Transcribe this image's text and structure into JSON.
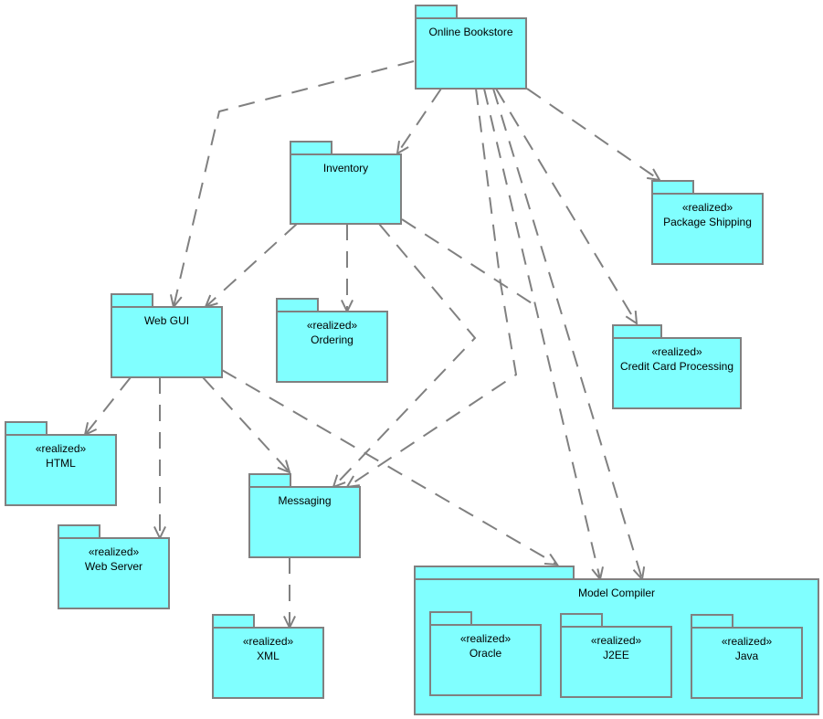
{
  "colors": {
    "fill": "#80ffff",
    "stroke": "#808080"
  },
  "packages": {
    "bookstore": {
      "name": "Online Bookstore",
      "stereotype": ""
    },
    "inventory": {
      "name": "Inventory",
      "stereotype": ""
    },
    "shipping": {
      "name": "Package Shipping",
      "stereotype": "«realized»"
    },
    "webgui": {
      "name": "Web GUI",
      "stereotype": ""
    },
    "ordering": {
      "name": "Ordering",
      "stereotype": "«realized»"
    },
    "credit": {
      "name": "Credit Card Processing",
      "stereotype": "«realized»"
    },
    "html": {
      "name": "HTML",
      "stereotype": "«realized»"
    },
    "messaging": {
      "name": "Messaging",
      "stereotype": ""
    },
    "webserver": {
      "name": "Web Server",
      "stereotype": "«realized»"
    },
    "xml": {
      "name": "XML",
      "stereotype": "«realized»"
    },
    "compiler": {
      "name": "Model Compiler",
      "stereotype": ""
    },
    "oracle": {
      "name": "Oracle",
      "stereotype": "«realized»"
    },
    "j2ee": {
      "name": "J2EE",
      "stereotype": "«realized»"
    },
    "java": {
      "name": "Java",
      "stereotype": "«realized»"
    }
  },
  "dependencies": [
    {
      "from": "bookstore",
      "to": "webgui"
    },
    {
      "from": "bookstore",
      "to": "inventory"
    },
    {
      "from": "bookstore",
      "to": "shipping"
    },
    {
      "from": "bookstore",
      "to": "credit"
    },
    {
      "from": "bookstore",
      "to": "messaging"
    },
    {
      "from": "bookstore",
      "to": "compiler"
    },
    {
      "from": "bookstore",
      "to": "compiler"
    },
    {
      "from": "inventory",
      "to": "webgui"
    },
    {
      "from": "inventory",
      "to": "ordering"
    },
    {
      "from": "inventory",
      "to": "messaging"
    },
    {
      "from": "inventory",
      "to": "compiler"
    },
    {
      "from": "webgui",
      "to": "html"
    },
    {
      "from": "webgui",
      "to": "webserver"
    },
    {
      "from": "webgui",
      "to": "messaging"
    },
    {
      "from": "webgui",
      "to": "compiler"
    },
    {
      "from": "messaging",
      "to": "xml"
    }
  ]
}
